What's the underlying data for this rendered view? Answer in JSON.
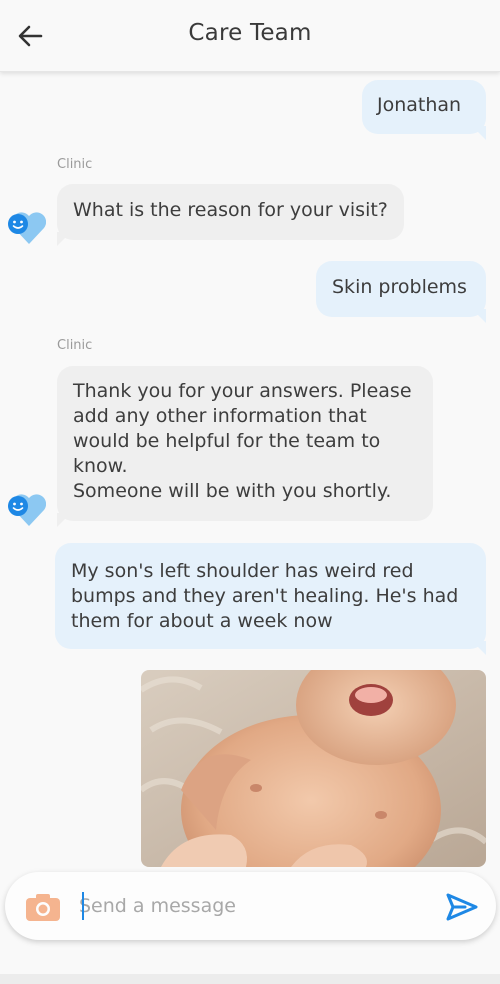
{
  "header": {
    "title": "Care Team",
    "back_icon": "arrow-left-icon"
  },
  "messages": [
    {
      "direction": "outgoing",
      "text": "Jonathan"
    },
    {
      "direction": "incoming",
      "sender": "Clinic",
      "text": "What is the reason for your visit?"
    },
    {
      "direction": "outgoing",
      "text": "Skin problems"
    },
    {
      "direction": "incoming",
      "sender": "Clinic",
      "lines": [
        "Thank you for your answers. Please",
        "add any other information that",
        "would be helpful for the team to",
        "know.",
        "Someone will be with you shortly."
      ]
    },
    {
      "direction": "outgoing",
      "lines": [
        "My son's left shoulder has weird red",
        "bumps and they aren't healing. He's had",
        "them for about a week now"
      ]
    },
    {
      "direction": "outgoing",
      "type": "image"
    }
  ],
  "composer": {
    "placeholder": "Send a message",
    "camera_icon": "camera-icon",
    "send_icon": "send-icon"
  },
  "colors": {
    "outgoing_bubble": "#e5f1fb",
    "incoming_bubble": "#efefef",
    "accent": "#1e88e5",
    "camera": "#f5b48f"
  }
}
